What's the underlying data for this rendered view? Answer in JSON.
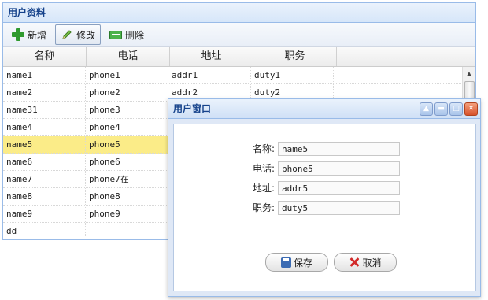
{
  "panel": {
    "title": "用户资料"
  },
  "toolbar": {
    "add_label": "新增",
    "edit_label": "修改",
    "delete_label": "删除"
  },
  "grid": {
    "columns": [
      "名称",
      "电话",
      "地址",
      "职务"
    ],
    "rows": [
      [
        "name1",
        "phone1",
        "addr1",
        "duty1"
      ],
      [
        "name2",
        "phone2",
        "addr2",
        "duty2"
      ],
      [
        "name31",
        "phone3",
        "",
        ""
      ],
      [
        "name4",
        "phone4",
        "",
        ""
      ],
      [
        "name5",
        "phone5",
        "",
        ""
      ],
      [
        "name6",
        "phone6",
        "",
        ""
      ],
      [
        "name7",
        "phone7在",
        "",
        ""
      ],
      [
        "name8",
        "phone8",
        "",
        ""
      ],
      [
        "name9",
        "phone9",
        "",
        ""
      ],
      [
        "dd",
        "",
        "",
        ""
      ],
      [
        "",
        "",
        "",
        ""
      ]
    ],
    "selected_row": 4
  },
  "window": {
    "title": "用户窗口",
    "fields": [
      {
        "label": "名称:",
        "value": "name5"
      },
      {
        "label": "电话:",
        "value": "phone5"
      },
      {
        "label": "地址:",
        "value": "addr5"
      },
      {
        "label": "职务:",
        "value": "duty5"
      }
    ],
    "save_label": "保存",
    "cancel_label": "取消"
  },
  "colors": {
    "header_text": "#15428b",
    "selected_row": "#fbec88",
    "border": "#99bbe8"
  }
}
